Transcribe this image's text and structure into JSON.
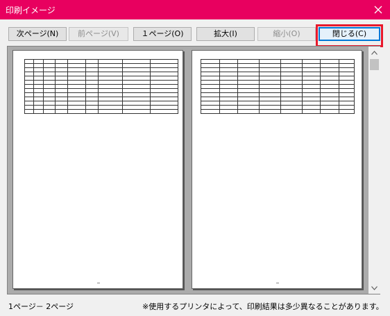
{
  "window": {
    "title": "印刷イメージ"
  },
  "toolbar": {
    "next_page": "次ページ(N)",
    "prev_page": "前ページ(V)",
    "one_page": "１ページ(O)",
    "zoom_in": "拡大(I)",
    "zoom_out": "縮小(O)",
    "close": "閉じる(C)"
  },
  "status": {
    "page_range": "1ページ－ 2ページ",
    "note": "※使用するプリンタによって、印刷結果は多少異なることがあります。"
  },
  "colors": {
    "titlebar": "#e8005f",
    "highlight": "#e8192c"
  }
}
